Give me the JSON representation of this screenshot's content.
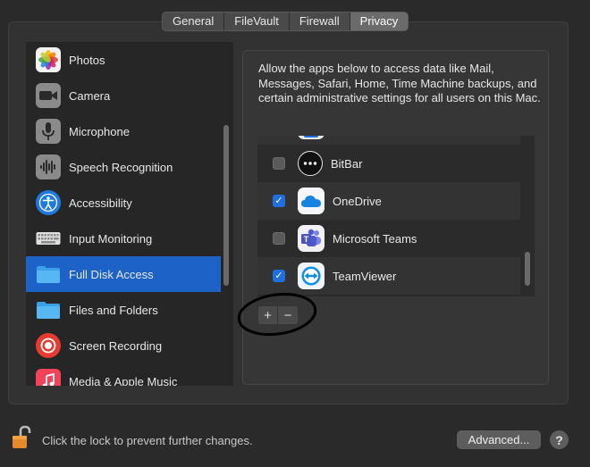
{
  "tabs": [
    {
      "label": "General",
      "active": false
    },
    {
      "label": "FileVault",
      "active": false
    },
    {
      "label": "Firewall",
      "active": false
    },
    {
      "label": "Privacy",
      "active": true
    }
  ],
  "sidebar": {
    "items": [
      {
        "label": "Photos",
        "icon": "photos-icon",
        "selected": false
      },
      {
        "label": "Camera",
        "icon": "camera-icon",
        "selected": false
      },
      {
        "label": "Microphone",
        "icon": "microphone-icon",
        "selected": false
      },
      {
        "label": "Speech Recognition",
        "icon": "speech-recognition-icon",
        "selected": false
      },
      {
        "label": "Accessibility",
        "icon": "accessibility-icon",
        "selected": false
      },
      {
        "label": "Input Monitoring",
        "icon": "keyboard-icon",
        "selected": false
      },
      {
        "label": "Full Disk Access",
        "icon": "folder-icon",
        "selected": true
      },
      {
        "label": "Files and Folders",
        "icon": "folder-icon",
        "selected": false
      },
      {
        "label": "Screen Recording",
        "icon": "screen-recording-icon",
        "selected": false
      },
      {
        "label": "Media & Apple Music",
        "icon": "music-icon",
        "selected": false
      }
    ]
  },
  "panel": {
    "description": "Allow the apps below to access data like Mail, Messages, Safari, Home, Time Machine backups, and certain administrative settings for all users on this Mac.",
    "apps": [
      {
        "name": "BitBar",
        "checked": false,
        "icon": "bitbar-icon"
      },
      {
        "name": "OneDrive",
        "checked": true,
        "icon": "onedrive-icon"
      },
      {
        "name": "Microsoft Teams",
        "checked": false,
        "icon": "teams-icon"
      },
      {
        "name": "TeamViewer",
        "checked": true,
        "icon": "teamviewer-icon"
      }
    ],
    "add_label": "+",
    "remove_label": "−"
  },
  "footer": {
    "lock_text": "Click the lock to prevent further changes.",
    "advanced_label": "Advanced...",
    "help_label": "?"
  },
  "colors": {
    "selection": "#1c62c7",
    "checkbox_on": "#1f6fe0",
    "lock": "#e58a2a"
  }
}
